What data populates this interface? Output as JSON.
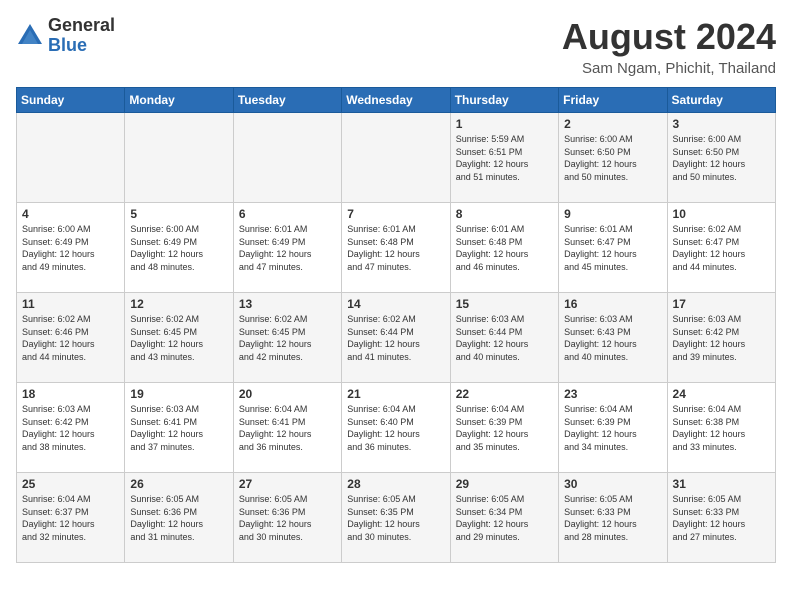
{
  "logo": {
    "general": "General",
    "blue": "Blue"
  },
  "title": {
    "month": "August 2024",
    "location": "Sam Ngam, Phichit, Thailand"
  },
  "weekdays": [
    "Sunday",
    "Monday",
    "Tuesday",
    "Wednesday",
    "Thursday",
    "Friday",
    "Saturday"
  ],
  "weeks": [
    [
      {
        "day": "",
        "info": ""
      },
      {
        "day": "",
        "info": ""
      },
      {
        "day": "",
        "info": ""
      },
      {
        "day": "",
        "info": ""
      },
      {
        "day": "1",
        "info": "Sunrise: 5:59 AM\nSunset: 6:51 PM\nDaylight: 12 hours\nand 51 minutes."
      },
      {
        "day": "2",
        "info": "Sunrise: 6:00 AM\nSunset: 6:50 PM\nDaylight: 12 hours\nand 50 minutes."
      },
      {
        "day": "3",
        "info": "Sunrise: 6:00 AM\nSunset: 6:50 PM\nDaylight: 12 hours\nand 50 minutes."
      }
    ],
    [
      {
        "day": "4",
        "info": "Sunrise: 6:00 AM\nSunset: 6:49 PM\nDaylight: 12 hours\nand 49 minutes."
      },
      {
        "day": "5",
        "info": "Sunrise: 6:00 AM\nSunset: 6:49 PM\nDaylight: 12 hours\nand 48 minutes."
      },
      {
        "day": "6",
        "info": "Sunrise: 6:01 AM\nSunset: 6:49 PM\nDaylight: 12 hours\nand 47 minutes."
      },
      {
        "day": "7",
        "info": "Sunrise: 6:01 AM\nSunset: 6:48 PM\nDaylight: 12 hours\nand 47 minutes."
      },
      {
        "day": "8",
        "info": "Sunrise: 6:01 AM\nSunset: 6:48 PM\nDaylight: 12 hours\nand 46 minutes."
      },
      {
        "day": "9",
        "info": "Sunrise: 6:01 AM\nSunset: 6:47 PM\nDaylight: 12 hours\nand 45 minutes."
      },
      {
        "day": "10",
        "info": "Sunrise: 6:02 AM\nSunset: 6:47 PM\nDaylight: 12 hours\nand 44 minutes."
      }
    ],
    [
      {
        "day": "11",
        "info": "Sunrise: 6:02 AM\nSunset: 6:46 PM\nDaylight: 12 hours\nand 44 minutes."
      },
      {
        "day": "12",
        "info": "Sunrise: 6:02 AM\nSunset: 6:45 PM\nDaylight: 12 hours\nand 43 minutes."
      },
      {
        "day": "13",
        "info": "Sunrise: 6:02 AM\nSunset: 6:45 PM\nDaylight: 12 hours\nand 42 minutes."
      },
      {
        "day": "14",
        "info": "Sunrise: 6:02 AM\nSunset: 6:44 PM\nDaylight: 12 hours\nand 41 minutes."
      },
      {
        "day": "15",
        "info": "Sunrise: 6:03 AM\nSunset: 6:44 PM\nDaylight: 12 hours\nand 40 minutes."
      },
      {
        "day": "16",
        "info": "Sunrise: 6:03 AM\nSunset: 6:43 PM\nDaylight: 12 hours\nand 40 minutes."
      },
      {
        "day": "17",
        "info": "Sunrise: 6:03 AM\nSunset: 6:42 PM\nDaylight: 12 hours\nand 39 minutes."
      }
    ],
    [
      {
        "day": "18",
        "info": "Sunrise: 6:03 AM\nSunset: 6:42 PM\nDaylight: 12 hours\nand 38 minutes."
      },
      {
        "day": "19",
        "info": "Sunrise: 6:03 AM\nSunset: 6:41 PM\nDaylight: 12 hours\nand 37 minutes."
      },
      {
        "day": "20",
        "info": "Sunrise: 6:04 AM\nSunset: 6:41 PM\nDaylight: 12 hours\nand 36 minutes."
      },
      {
        "day": "21",
        "info": "Sunrise: 6:04 AM\nSunset: 6:40 PM\nDaylight: 12 hours\nand 36 minutes."
      },
      {
        "day": "22",
        "info": "Sunrise: 6:04 AM\nSunset: 6:39 PM\nDaylight: 12 hours\nand 35 minutes."
      },
      {
        "day": "23",
        "info": "Sunrise: 6:04 AM\nSunset: 6:39 PM\nDaylight: 12 hours\nand 34 minutes."
      },
      {
        "day": "24",
        "info": "Sunrise: 6:04 AM\nSunset: 6:38 PM\nDaylight: 12 hours\nand 33 minutes."
      }
    ],
    [
      {
        "day": "25",
        "info": "Sunrise: 6:04 AM\nSunset: 6:37 PM\nDaylight: 12 hours\nand 32 minutes."
      },
      {
        "day": "26",
        "info": "Sunrise: 6:05 AM\nSunset: 6:36 PM\nDaylight: 12 hours\nand 31 minutes."
      },
      {
        "day": "27",
        "info": "Sunrise: 6:05 AM\nSunset: 6:36 PM\nDaylight: 12 hours\nand 30 minutes."
      },
      {
        "day": "28",
        "info": "Sunrise: 6:05 AM\nSunset: 6:35 PM\nDaylight: 12 hours\nand 30 minutes."
      },
      {
        "day": "29",
        "info": "Sunrise: 6:05 AM\nSunset: 6:34 PM\nDaylight: 12 hours\nand 29 minutes."
      },
      {
        "day": "30",
        "info": "Sunrise: 6:05 AM\nSunset: 6:33 PM\nDaylight: 12 hours\nand 28 minutes."
      },
      {
        "day": "31",
        "info": "Sunrise: 6:05 AM\nSunset: 6:33 PM\nDaylight: 12 hours\nand 27 minutes."
      }
    ]
  ]
}
